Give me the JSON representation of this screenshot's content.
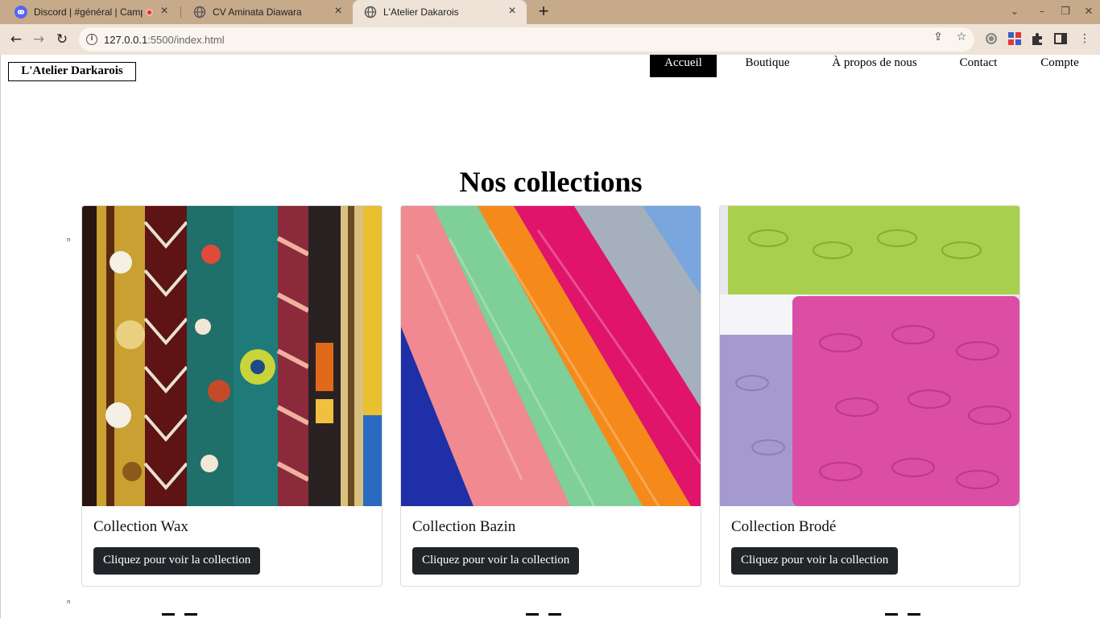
{
  "browser": {
    "tabs": [
      {
        "title": "Discord | #général | Campus",
        "icon": "discord-icon",
        "recording": true,
        "active": false
      },
      {
        "title": "CV Aminata Diawara",
        "icon": "globe-icon",
        "active": false
      },
      {
        "title": "L'Atelier Dakarois",
        "icon": "globe-icon",
        "active": true
      }
    ],
    "close_glyph": "×",
    "new_tab_glyph": "+",
    "url_host": "127.0.0.1",
    "url_path": ":5500/index.html",
    "accent_discord": "#5865f2"
  },
  "site": {
    "brand": "L'Atelier Darkarois",
    "nav": [
      {
        "label": "Accueil",
        "active": true
      },
      {
        "label": "Boutique",
        "active": false
      },
      {
        "label": "À propos de nous",
        "active": false
      },
      {
        "label": "Contact",
        "active": false
      },
      {
        "label": "Compte",
        "active": false
      }
    ],
    "section_title": "Nos collections",
    "marker_glyph": "n",
    "collections": [
      {
        "title": "Collection Wax",
        "button": "Cliquez pour voir la collection",
        "image": "wax-fabric-image"
      },
      {
        "title": "Collection Bazin",
        "button": "Cliquez pour voir la collection",
        "image": "bazin-fabric-image"
      },
      {
        "title": "Collection Brodé",
        "button": "Cliquez pour voir la collection",
        "image": "embroidered-fabric-image"
      }
    ]
  }
}
